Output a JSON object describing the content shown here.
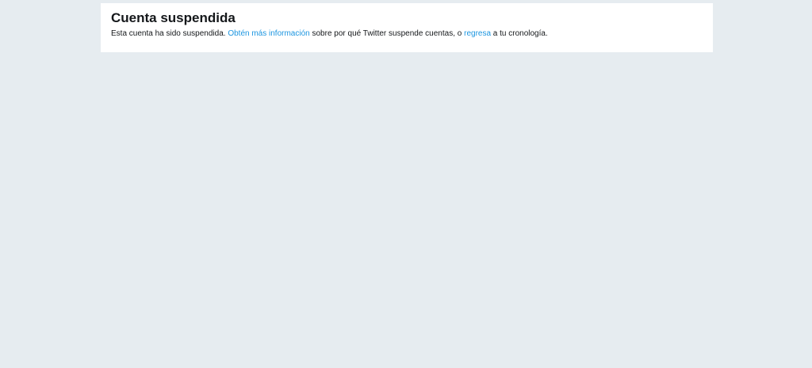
{
  "suspension_card": {
    "title": "Cuenta suspendida",
    "message": {
      "part1": "Esta cuenta ha sido suspendida. ",
      "learn_more_link": "Obtén más información",
      "part2": " sobre por qué Twitter suspende cuentas, o ",
      "go_back_link": "regresa",
      "part3": " a tu cronología."
    }
  },
  "colors": {
    "background": "#e6ecf0",
    "card": "#ffffff",
    "text": "#14171a",
    "link": "#1b95e0"
  }
}
